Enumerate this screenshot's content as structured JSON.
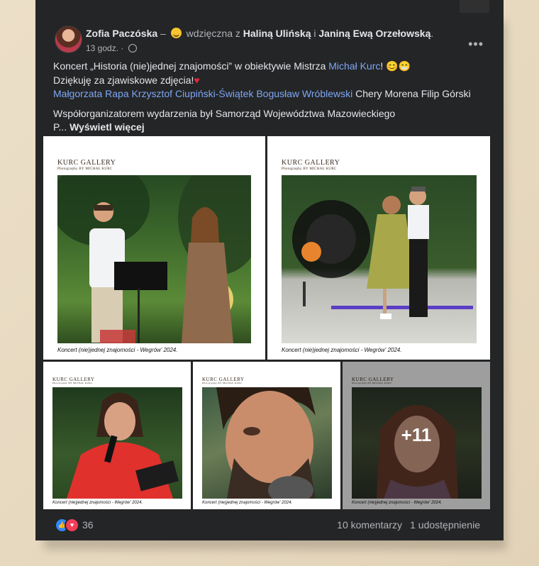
{
  "post": {
    "author": "Zofia Paczóska",
    "feeling_prefix": "–",
    "feeling": "wdzięczna z",
    "tagged_1": "Haliną Ulińską",
    "tag_connector": "i",
    "tagged_2": "Janiną Ewą Orzełowską",
    "tag_end": ".",
    "time": "13 godz.",
    "time_sep": "·",
    "privacy_icon": "globe-icon",
    "more_icon": "ellipsis-icon",
    "more_label": "•••",
    "text": {
      "line1_pre": "Koncert „Historia (nie)jednej znajomości” w obiektywie Mistrza ",
      "line1_link": "Michał Kurc",
      "line1_post": "! ",
      "line1_emoji": "😊😁",
      "line2": "Dziękuję za zjawiskowe zdjęcia!",
      "line2_emoji": "♥",
      "tags_links": "Małgorzata Rapa Krzysztof Ciupiński-Świątek Bogusław Wróblewski",
      "tags_plain": " Chery Morena Filip Górski",
      "line4": "Współorganizatorem wydarzenia był Samorząd Województwa Mazowieckiego",
      "line5_pre": "P... ",
      "see_more": "Wyświetl więcej"
    },
    "photos": [
      {
        "gallery": "KURC GALLERY",
        "sub": "Photography BY MICHAŁ KURC",
        "caption": "Koncert (nie)jednej znajomości - Wegrów' 2024."
      },
      {
        "gallery": "KURC GALLERY",
        "sub": "Photography BY MICHAŁ KURC",
        "caption": "Koncert (nie)jednej znajomości - Wegrów' 2024."
      },
      {
        "gallery": "KURC GALLERY",
        "sub": "Photography BY MICHAŁ KURC",
        "caption": "Koncert (nie)jednej znajomości - Wegrów' 2024."
      },
      {
        "gallery": "KURC GALLERY",
        "sub": "Photography BY MICHAŁ KURC",
        "caption": "Koncert (nie)jednej znajomości - Wegrów' 2024."
      },
      {
        "gallery": "KURC GALLERY",
        "sub": "Photography BY MICHAŁ KURC",
        "caption": "Koncert (nie)jednej znajomości - Wegrów' 2024."
      }
    ],
    "more_photos": "+11",
    "reactions": {
      "like_icon": "👍",
      "love_icon": "♥",
      "count": "36"
    },
    "comments": "10 komentarzy",
    "shares": "1 udostępnienie"
  },
  "colors": {
    "background": "#242526",
    "text": "#e4e6eb",
    "secondary": "#b0b3b8",
    "link": "#7ea7f5",
    "like": "#2e89ff",
    "love": "#f33e58"
  }
}
